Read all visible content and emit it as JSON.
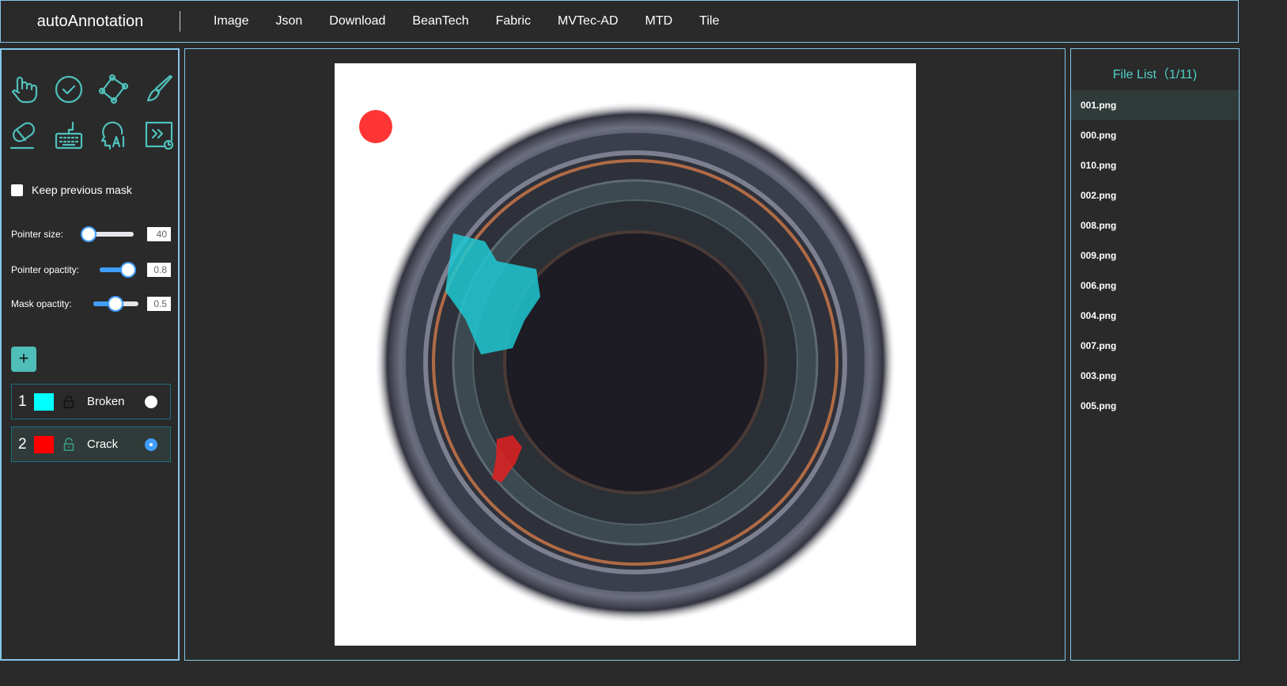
{
  "header": {
    "brand": "autoAnnotation",
    "nav": [
      "Image",
      "Json",
      "Download",
      "BeanTech",
      "Fabric",
      "MVTec-AD",
      "MTD",
      "Tile"
    ]
  },
  "tools": [
    "pointer-icon",
    "check-icon",
    "polygon-icon",
    "brush-icon",
    "eraser-icon",
    "keyboard-icon",
    "ai-icon",
    "auto-run-icon"
  ],
  "keep_mask": {
    "label": "Keep previous mask",
    "checked": false
  },
  "sliders": [
    {
      "label": "Pointer size:",
      "value": "40",
      "fraction": 0.0
    },
    {
      "label": "Pointer opactity:",
      "value": "0.8",
      "fraction": 0.8
    },
    {
      "label": "Mask opactity:",
      "value": "0.5",
      "fraction": 0.5
    }
  ],
  "add_label": "+",
  "labels": [
    {
      "num": "1",
      "name": "Broken",
      "color": "#00ffff",
      "locked": true,
      "selected": false
    },
    {
      "num": "2",
      "name": "Crack",
      "color": "#ff0000",
      "locked": false,
      "selected": true
    }
  ],
  "file_list": {
    "title": "File List（1/11)",
    "files": [
      "001.png",
      "000.png",
      "010.png",
      "002.png",
      "008.png",
      "009.png",
      "006.png",
      "004.png",
      "007.png",
      "003.png",
      "005.png"
    ],
    "selected": 0
  }
}
